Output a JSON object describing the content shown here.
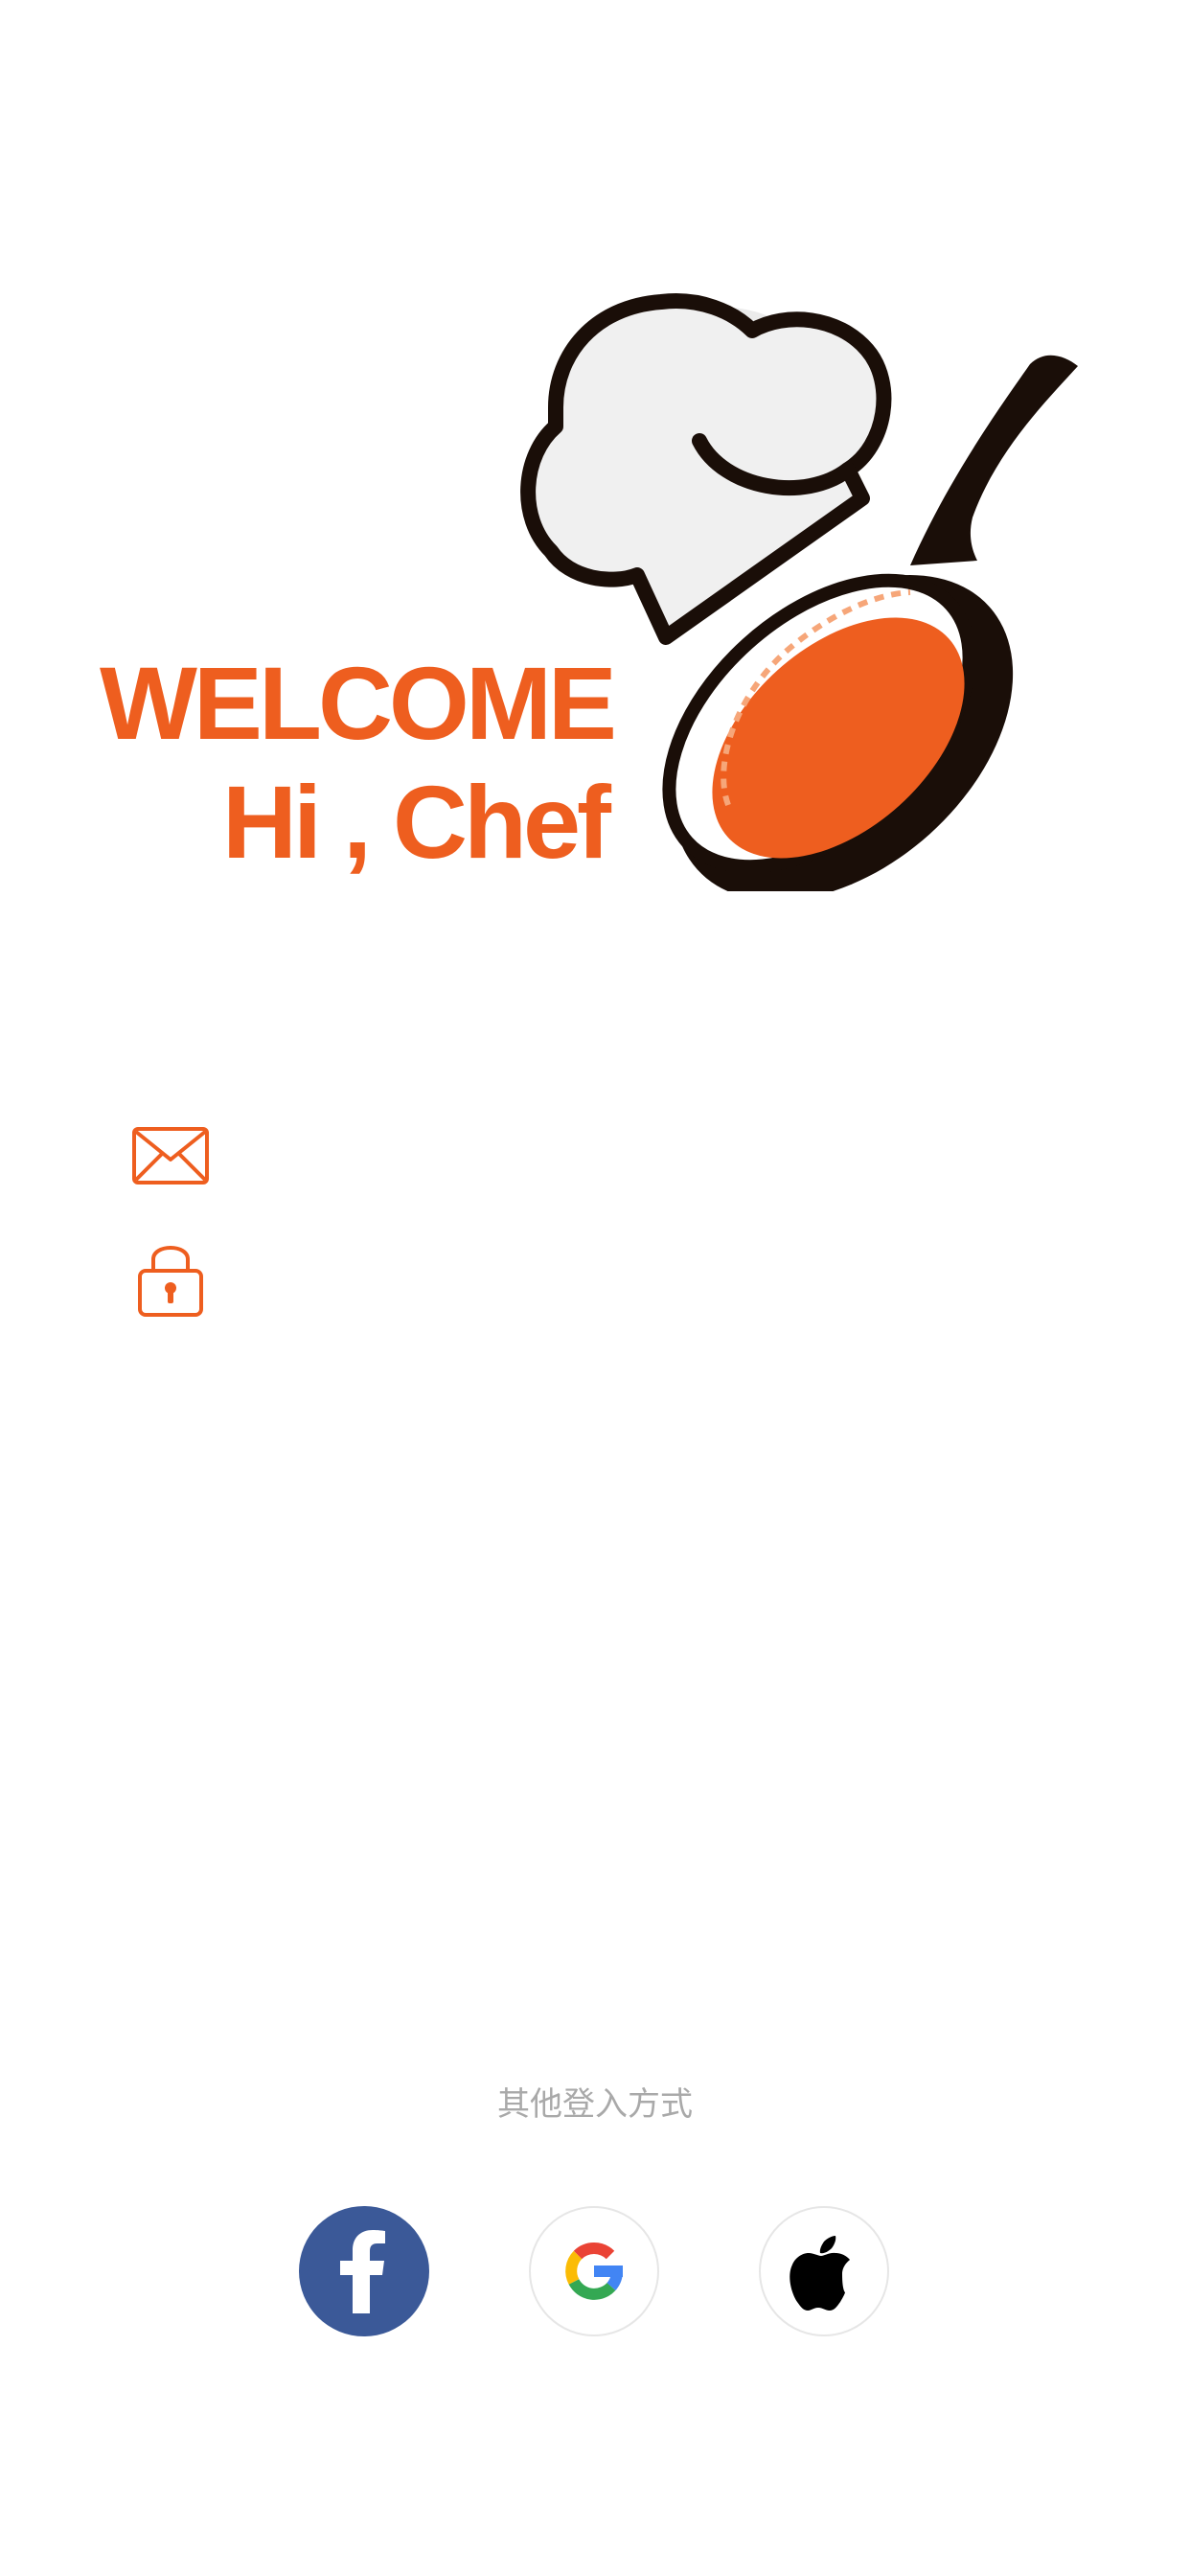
{
  "welcome": {
    "line1": "WELCOME",
    "line2": "Hi , Chef"
  },
  "login_form": {
    "email_icon": "envelope-icon",
    "password_icon": "lock-icon",
    "email_placeholder": "",
    "password_placeholder": ""
  },
  "other_login": {
    "label": "其他登入方式",
    "providers": [
      {
        "name": "Facebook",
        "icon": "facebook-icon",
        "color": "#3B5998"
      },
      {
        "name": "Google",
        "icon": "google-icon"
      },
      {
        "name": "Apple",
        "icon": "apple-icon",
        "color": "#000000"
      }
    ]
  },
  "colors": {
    "brand_orange": "#EE5E1F",
    "muted_text": "#A9A9A9"
  }
}
